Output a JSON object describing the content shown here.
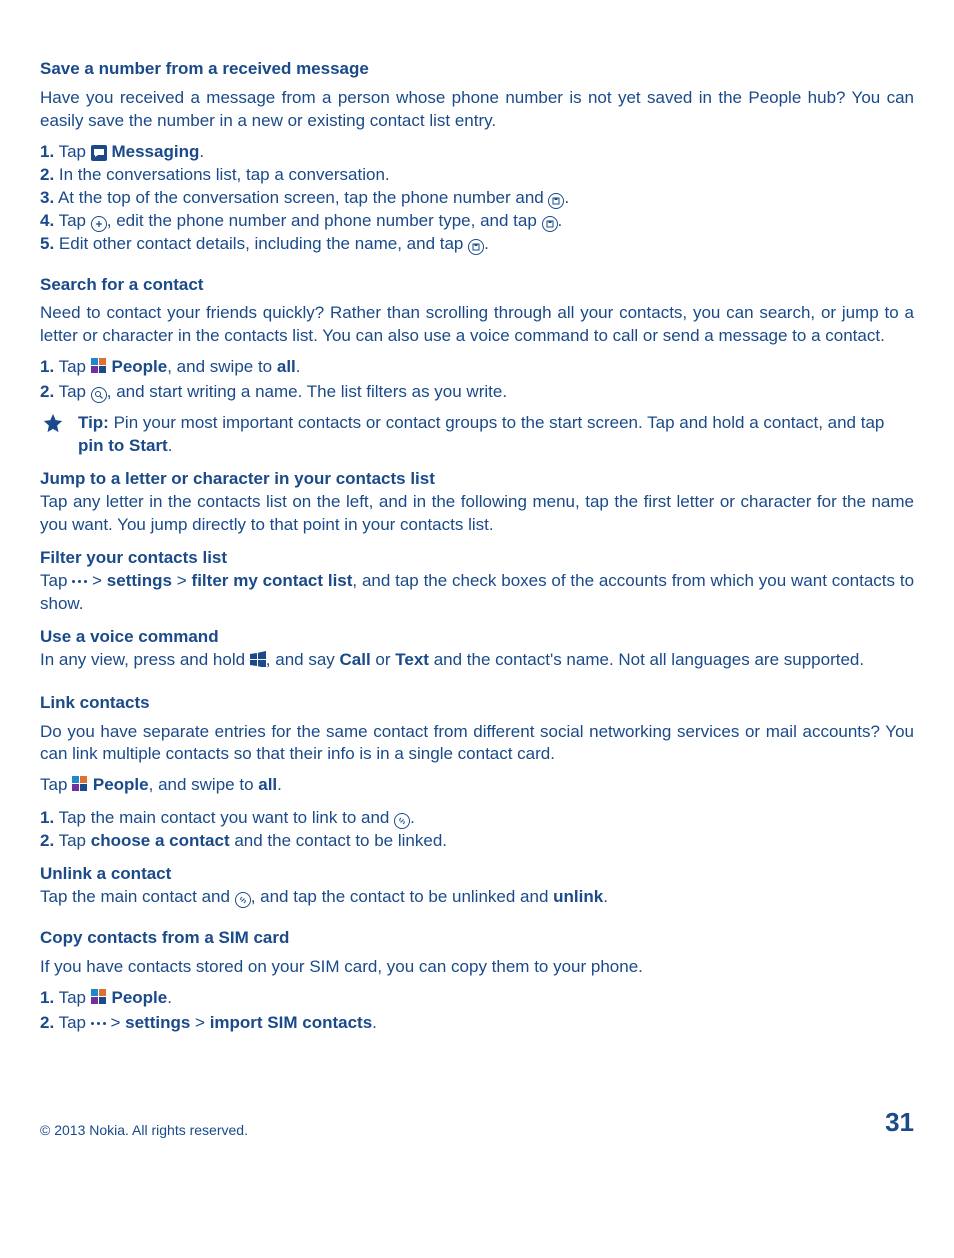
{
  "sec1": {
    "heading": "Save a number from a received message",
    "para": "Have you received a message from a person whose phone number is not yet saved in the People hub? You can easily save the number in a new or existing contact list entry.",
    "s1_a": "1.",
    "s1_b": " Tap ",
    "s1_c": "Messaging",
    "s1_d": ".",
    "s2_a": "2.",
    "s2_b": " In the conversations list, tap a conversation.",
    "s3_a": "3.",
    "s3_b": " At the top of the conversation screen, tap the phone number and ",
    "s3_c": ".",
    "s4_a": "4.",
    "s4_b": " Tap ",
    "s4_c": ", edit the phone number and phone number type, and tap ",
    "s4_d": ".",
    "s5_a": "5.",
    "s5_b": " Edit other contact details, including the name, and tap ",
    "s5_c": "."
  },
  "sec2": {
    "heading": "Search for a contact",
    "para": "Need to contact your friends quickly? Rather than scrolling through all your contacts, you can search, or jump to a letter or character in the contacts list. You can also use a voice command to call or send a message to a contact.",
    "s1_a": "1.",
    "s1_b": " Tap ",
    "s1_c": "People",
    "s1_d": ", and swipe to ",
    "s1_e": "all",
    "s1_f": ".",
    "s2_a": "2.",
    "s2_b": " Tap ",
    "s2_c": ", and start writing a name. The list filters as you write.",
    "tip_a": "Tip:",
    "tip_b": " Pin your most important contacts or contact groups to the start screen. Tap and hold a contact, and tap ",
    "tip_c": "pin to Start",
    "tip_d": "."
  },
  "sec3": {
    "heading": "Jump to a letter or character in your contacts list",
    "para": "Tap any letter in the contacts list on the left, and in the following menu, tap the first letter or character for the name you want. You jump directly to that point in your contacts list."
  },
  "sec4": {
    "heading": "Filter your contacts list",
    "p_a": "Tap ",
    "p_b": " > ",
    "p_c": "settings",
    "p_d": " > ",
    "p_e": "filter my contact list",
    "p_f": ", and tap the check boxes of the accounts from which you want contacts to show."
  },
  "sec5": {
    "heading": "Use a voice command",
    "p_a": "In any view, press and hold ",
    "p_b": ", and say ",
    "p_c": "Call",
    "p_d": " or ",
    "p_e": "Text",
    "p_f": " and the contact's name. Not all languages are supported."
  },
  "sec6": {
    "heading": "Link contacts",
    "para": "Do you have separate entries for the same contact from different social networking services or mail accounts? You can link multiple contacts so that their info is in a single contact card.",
    "t_a": "Tap ",
    "t_b": "People",
    "t_c": ", and swipe to ",
    "t_d": "all",
    "t_e": ".",
    "s1_a": "1.",
    "s1_b": " Tap the main contact you want to link to and ",
    "s1_c": ".",
    "s2_a": "2.",
    "s2_b": " Tap ",
    "s2_c": "choose a contact",
    "s2_d": " and the contact to be linked."
  },
  "sec7": {
    "heading": "Unlink a contact",
    "p_a": "Tap the main contact and ",
    "p_b": ", and tap the contact to be unlinked and ",
    "p_c": "unlink",
    "p_d": "."
  },
  "sec8": {
    "heading": "Copy contacts from a SIM card",
    "para": "If you have contacts stored on your SIM card, you can copy them to your phone.",
    "s1_a": "1.",
    "s1_b": " Tap ",
    "s1_c": "People",
    "s1_d": ".",
    "s2_a": "2.",
    "s2_b": " Tap ",
    "s2_c": " > ",
    "s2_d": "settings",
    "s2_e": " > ",
    "s2_f": "import SIM contacts",
    "s2_g": "."
  },
  "footer": {
    "copyright": "© 2013 Nokia. All rights reserved.",
    "page": "31"
  }
}
